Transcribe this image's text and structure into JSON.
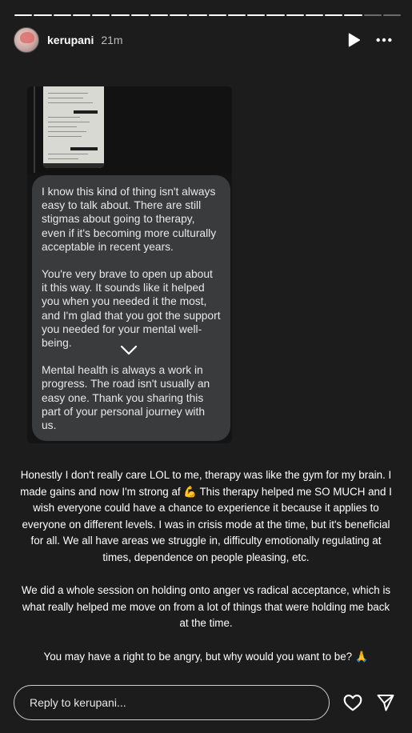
{
  "progress": {
    "total_segments": 20,
    "completed_segments": 18
  },
  "header": {
    "username": "kerupani",
    "time": "21m",
    "play_icon": "play-icon",
    "more_icon": "more-icon"
  },
  "screenshot": {
    "messages": [
      "I know this kind of thing isn't always easy to talk about. There are still stigmas about going to therapy, even if it's becoming more culturally acceptable in recent years.",
      "You're very brave to open up about it this way. It sounds like it helped you when you needed it the most, and I'm glad that you got the support you needed for your mental well-being.",
      "Mental health is always a work in progress. The road isn't usually an easy one. Thank you sharing this part of your personal journey with us."
    ]
  },
  "caption": {
    "paragraphs": [
      "Honestly I don't really care LOL to me, therapy was like the gym for my brain. I made gains and now I'm strong af 💪 This therapy helped me SO MUCH and I wish everyone could have a chance to experience it because it applies to everyone on different levels. I was in crisis mode at the time, but it's beneficial for all. We all have areas we struggle in, difficulty emotionally regulating at times, dependence on people pleasing, etc.",
      "We did a whole session on holding onto anger vs radical acceptance, which is what really helped me move on from a lot of things that were holding me back at the time.",
      "You may have a right to be angry, but why would you want to be? 🙏"
    ]
  },
  "footer": {
    "reply_placeholder": "Reply to kerupani...",
    "heart_icon": "heart-icon",
    "send_icon": "send-icon"
  },
  "colors": {
    "background": "#1c1c1c",
    "bubble": "#3a3b3d",
    "text": "#ffffff"
  }
}
